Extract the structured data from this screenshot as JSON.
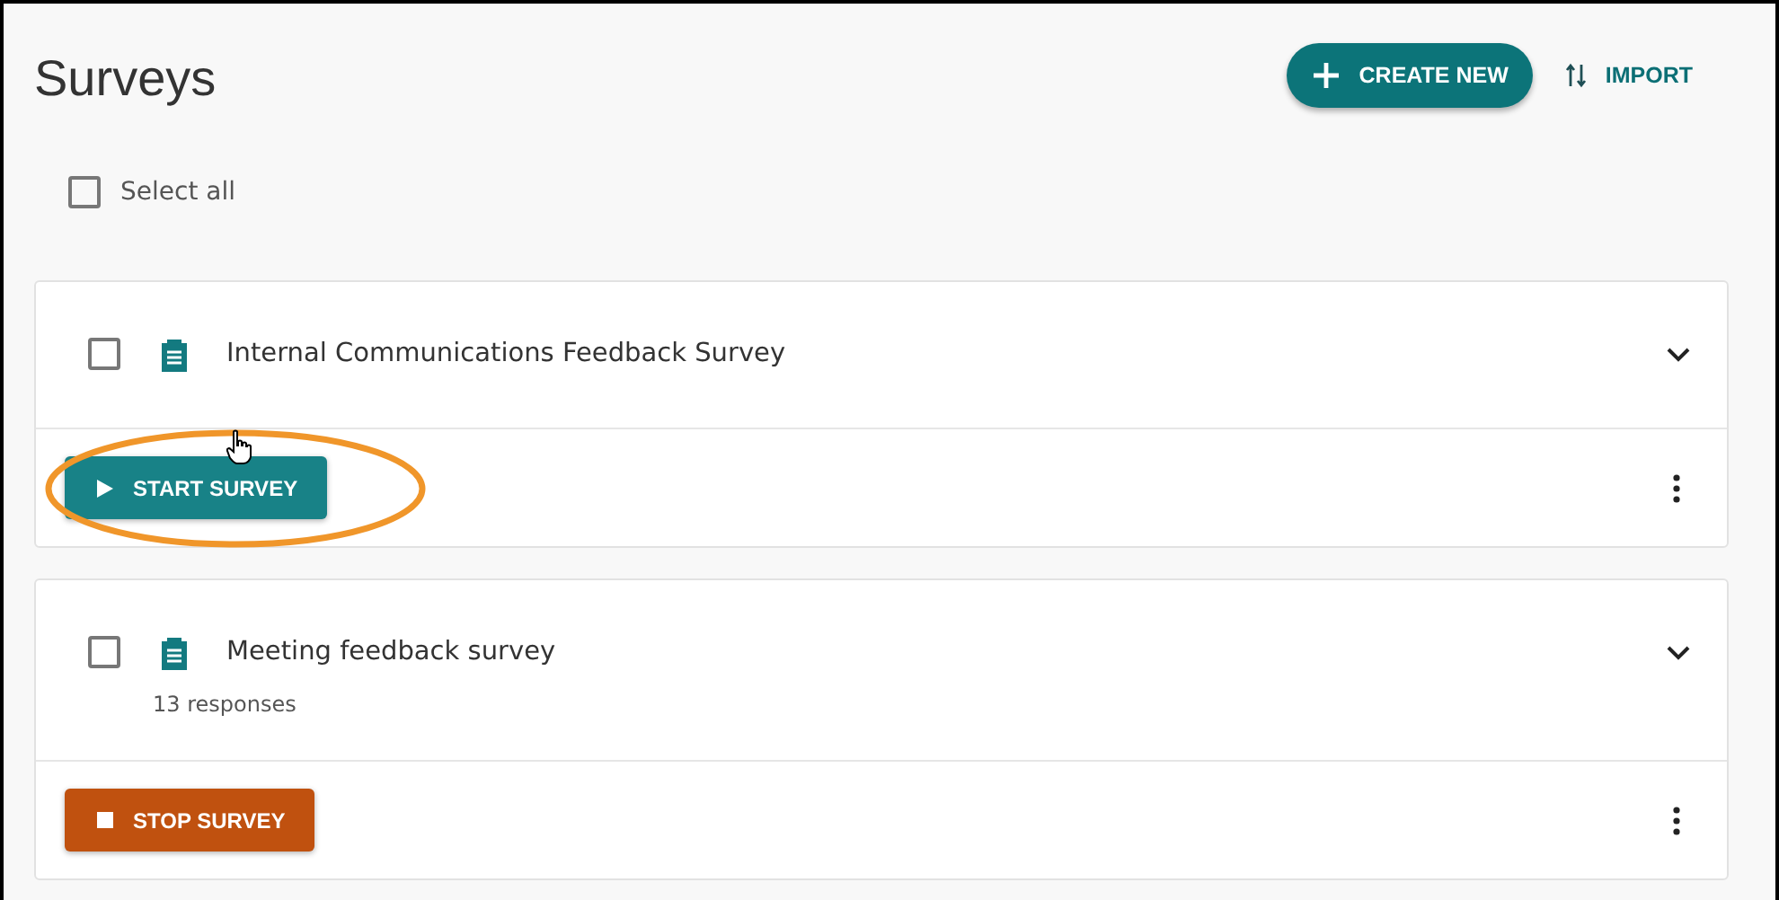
{
  "page": {
    "title": "Surveys"
  },
  "header_actions": [
    {
      "kind": "create",
      "label": "CREATE NEW"
    },
    {
      "kind": "import",
      "label": "IMPORT"
    }
  ],
  "select_all": {
    "label": "Select all",
    "checked": false
  },
  "surveys": [
    {
      "title": "Internal Communications Feedback Survey",
      "checked": false,
      "action": {
        "kind": "start",
        "label": "START SURVEY",
        "highlighted": true
      }
    },
    {
      "title": "Meeting feedback survey",
      "checked": false,
      "responses": "13 responses",
      "action": {
        "kind": "stop",
        "label": "STOP SURVEY",
        "highlighted": false
      }
    }
  ]
}
